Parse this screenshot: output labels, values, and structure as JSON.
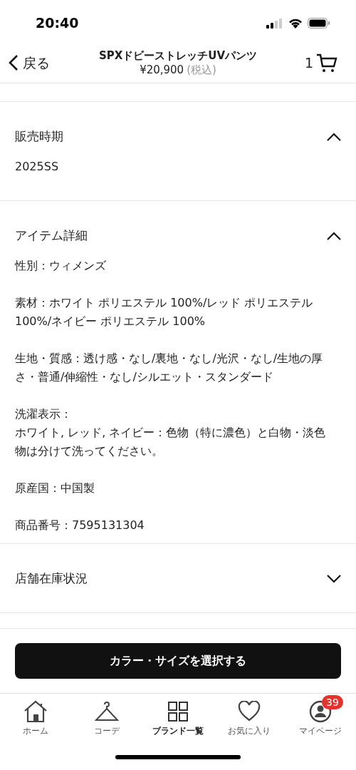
{
  "status_bar": {
    "time": "20:40"
  },
  "header": {
    "back": "戻る",
    "title": "SPXドビーストレッチUVパンツ",
    "price": "¥20,900",
    "tax": "(税込)",
    "cart_count": "1"
  },
  "sections": [
    {
      "title": "販売時期",
      "expanded": true,
      "paragraphs": [
        [
          "2025SS"
        ]
      ]
    },
    {
      "title": "アイテム詳細",
      "expanded": true,
      "paragraphs": [
        [
          "性別：ウィメンズ"
        ],
        [
          "素材：ホワイト ポリエステル 100%/レッド ポリエステル 100%/ネイビー ポリエステル 100%"
        ],
        [
          "生地・質感：透け感・なし/裏地・なし/光沢・なし/生地の厚さ・普通/伸縮性・なし/シルエット・スタンダード"
        ],
        [
          "洗濯表示：",
          "ホワイト, レッド, ネイビー：色物（特に濃色）と白物・淡色物は分けて洗ってください。"
        ],
        [
          "原産国：中国製"
        ],
        [
          "商品番号：7595131304"
        ]
      ]
    },
    {
      "title": "店舗在庫状況",
      "expanded": false
    }
  ],
  "action_button": "カラー・サイズを選択する",
  "tabs": [
    {
      "kind": "home",
      "label": "ホーム",
      "selected": false
    },
    {
      "kind": "hanger",
      "label": "コーデ",
      "selected": false
    },
    {
      "kind": "grid",
      "label": "ブランド一覧",
      "selected": true
    },
    {
      "kind": "heart",
      "label": "お気に入り",
      "selected": false
    },
    {
      "kind": "person",
      "label": "マイページ",
      "selected": false,
      "badge": "39"
    }
  ]
}
